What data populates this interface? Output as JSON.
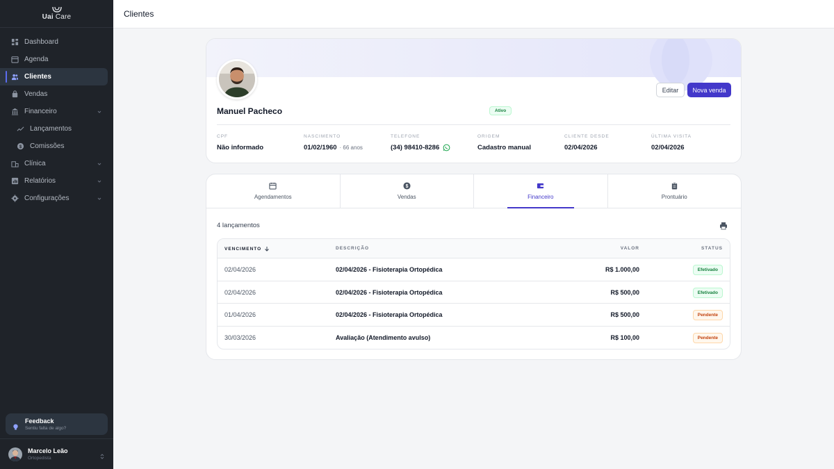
{
  "app": {
    "logo_text_bold": "Uai",
    "logo_text_regular": "Care"
  },
  "header": {
    "title": "Clientes"
  },
  "sidebar": {
    "items": [
      {
        "label": "Dashboard",
        "icon": "dashboard-icon"
      },
      {
        "label": "Agenda",
        "icon": "calendar-icon"
      },
      {
        "label": "Clientes",
        "icon": "users-icon",
        "active": true
      },
      {
        "label": "Vendas",
        "icon": "bag-icon"
      },
      {
        "label": "Financeiro",
        "icon": "bank-icon",
        "expandable": true
      },
      {
        "label": "Lançamentos",
        "icon": "trend-icon",
        "sub": true
      },
      {
        "label": "Comissões",
        "icon": "dollar-icon",
        "sub": true
      },
      {
        "label": "Clínica",
        "icon": "building-icon",
        "expandable": true
      },
      {
        "label": "Relatórios",
        "icon": "report-icon",
        "expandable": true
      },
      {
        "label": "Configurações",
        "icon": "gear-icon",
        "expandable": true
      }
    ],
    "feedback": {
      "title": "Feedback",
      "subtitle": "Sentiu falta de algo?"
    },
    "user": {
      "name": "Marcelo Leão",
      "role": "Ortopedista"
    }
  },
  "profile": {
    "name": "Manuel Pacheco",
    "status": "Ativo",
    "edit_label": "Editar",
    "new_sale_label": "Nova venda",
    "fields": [
      {
        "label": "CPF",
        "value": "Não informado"
      },
      {
        "label": "Nascimento",
        "value": "01/02/1960",
        "extra": "· 66 anos"
      },
      {
        "label": "Telefone",
        "value": "(34) 98410-8286"
      },
      {
        "label": "Origem",
        "value": "Cadastro manual"
      },
      {
        "label": "Cliente desde",
        "value": "02/04/2026"
      },
      {
        "label": "Última visita",
        "value": "02/04/2026"
      }
    ]
  },
  "tabs": [
    {
      "label": "Agendamentos",
      "icon": "calendar-icon"
    },
    {
      "label": "Vendas",
      "icon": "dollar-icon"
    },
    {
      "label": "Financeiro",
      "icon": "wallet-icon",
      "active": true
    },
    {
      "label": "Prontuário",
      "icon": "clipboard-icon"
    }
  ],
  "finance": {
    "count_label": "4 lançamentos",
    "columns": {
      "vencimento": "Vencimento",
      "descricao": "Descrição",
      "valor": "Valor",
      "status": "Status"
    },
    "rows": [
      {
        "date": "02/04/2026",
        "desc": "02/04/2026 - Fisioterapia Ortopédica",
        "valor": "R$ 1.000,00",
        "status": "Efetivado"
      },
      {
        "date": "02/04/2026",
        "desc": "02/04/2026 - Fisioterapia Ortopédica",
        "valor": "R$ 500,00",
        "status": "Efetivado"
      },
      {
        "date": "01/04/2026",
        "desc": "02/04/2026 - Fisioterapia Ortopédica",
        "valor": "R$ 500,00",
        "status": "Pendente"
      },
      {
        "date": "30/03/2026",
        "desc": "Avaliação (Atendimento avulso)",
        "valor": "R$ 100,00",
        "status": "Pendente"
      }
    ]
  },
  "colors": {
    "accent": "#4338ca",
    "sidebar_bg": "#1f2329",
    "success": "#15803d",
    "warning": "#c2410c"
  }
}
